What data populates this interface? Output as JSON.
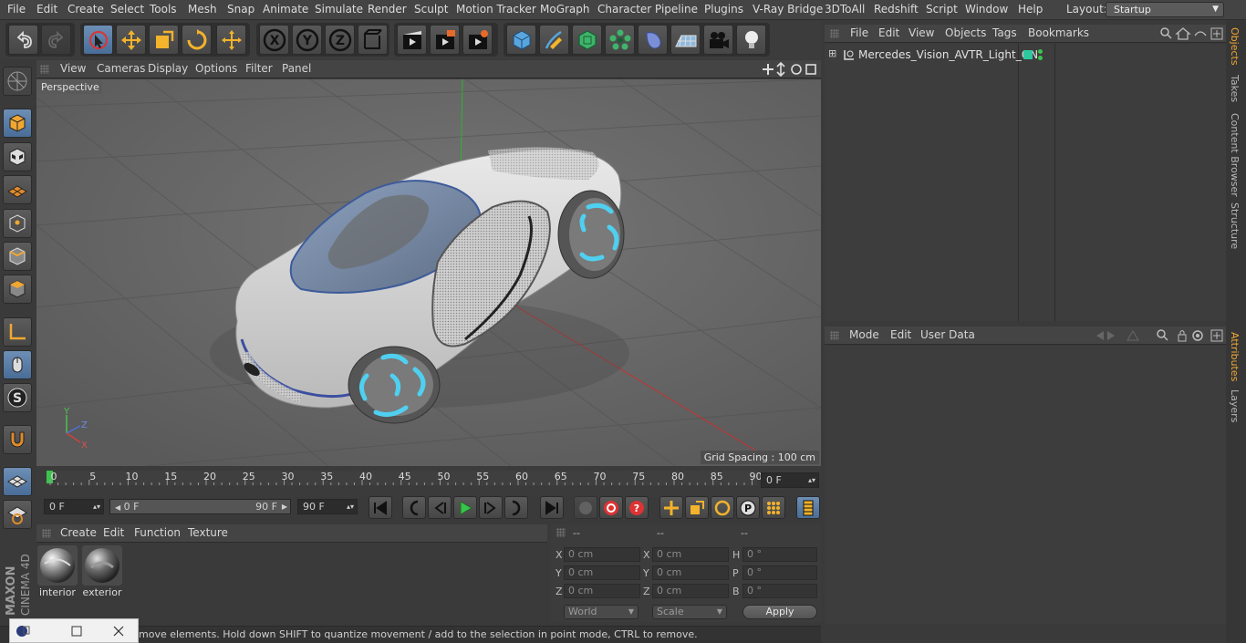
{
  "menubar": {
    "items": [
      "File",
      "Edit",
      "Create",
      "Select",
      "Tools",
      "Mesh",
      "Snap",
      "Animate",
      "Simulate",
      "Render",
      "Sculpt",
      "Motion Tracker",
      "MoGraph",
      "Character",
      "Pipeline",
      "Plugins",
      "V-Ray Bridge",
      "3DToAll",
      "Redshift",
      "Script",
      "Window",
      "Help"
    ],
    "layout_label": "Layout:",
    "layout_value": "Startup"
  },
  "toolbar": {
    "icons": [
      "undo-icon",
      "redo-icon",
      "live-selection-icon",
      "move-icon",
      "scale-icon",
      "rotate-icon",
      "last-tool-icon",
      "x-axis-icon",
      "y-axis-icon",
      "z-axis-icon",
      "coordinate-system-icon",
      "render-view-icon",
      "render-picture-viewer-icon",
      "edit-render-settings-icon",
      "cube-icon",
      "pen-icon",
      "subdivision-icon",
      "cloner-icon",
      "deformer-icon",
      "floor-icon",
      "camera-icon",
      "light-icon"
    ],
    "axis_labels": [
      "X",
      "Y",
      "Z"
    ]
  },
  "viewport": {
    "menu": [
      "View",
      "Cameras",
      "Display",
      "Options",
      "Filter",
      "Panel"
    ],
    "label": "Perspective",
    "grid_spacing": "Grid Spacing : 100 cm",
    "gizmo_labels": [
      "Y",
      "Z",
      "X"
    ]
  },
  "timeline": {
    "ticks": [
      "0",
      "5",
      "10",
      "15",
      "20",
      "25",
      "30",
      "35",
      "40",
      "45",
      "50",
      "55",
      "60",
      "65",
      "70",
      "75",
      "80",
      "85",
      "90"
    ],
    "current_frame": "0 F"
  },
  "playbar": {
    "start_field": "0 F",
    "range_start": "0 F",
    "range_end": "90 F",
    "end_field": "90 F"
  },
  "material_manager": {
    "menu": [
      "Create",
      "Edit",
      "Function",
      "Texture"
    ],
    "materials": [
      "interior",
      "exterior"
    ]
  },
  "coordinates": {
    "col_headers": [
      "--",
      "--",
      "--"
    ],
    "rows": [
      {
        "a_label": "X",
        "a_val": "0 cm",
        "b_label": "X",
        "b_val": "0 cm",
        "c_label": "H",
        "c_val": "0 °"
      },
      {
        "a_label": "Y",
        "a_val": "0 cm",
        "b_label": "Y",
        "b_val": "0 cm",
        "c_label": "P",
        "c_val": "0 °"
      },
      {
        "a_label": "Z",
        "a_val": "0 cm",
        "b_label": "Z",
        "b_val": "0 cm",
        "c_label": "B",
        "c_val": "0 °"
      }
    ],
    "mode_select": "World",
    "size_select": "Scale",
    "apply_label": "Apply"
  },
  "status": {
    "text": "move elements. Hold down SHIFT to quantize movement / add to the selection in point mode, CTRL to remove."
  },
  "object_manager": {
    "menu": [
      "File",
      "Edit",
      "View",
      "Objects",
      "Tags",
      "Bookmarks"
    ],
    "objects": [
      {
        "name": "Mercedes_Vision_AVTR_Light_ON"
      }
    ]
  },
  "attribute_manager": {
    "menu": [
      "Mode",
      "Edit",
      "User Data"
    ]
  },
  "side_tabs": [
    "Objects",
    "Takes",
    "Content Browser",
    "Structure",
    "Attributes",
    "Layers"
  ],
  "branding": {
    "maxon": "MAXON",
    "product": "CINEMA 4D"
  },
  "colors": {
    "accent": "#f0a732",
    "selected_tool": "#5b80ad",
    "viewport_bg": "#636363"
  }
}
